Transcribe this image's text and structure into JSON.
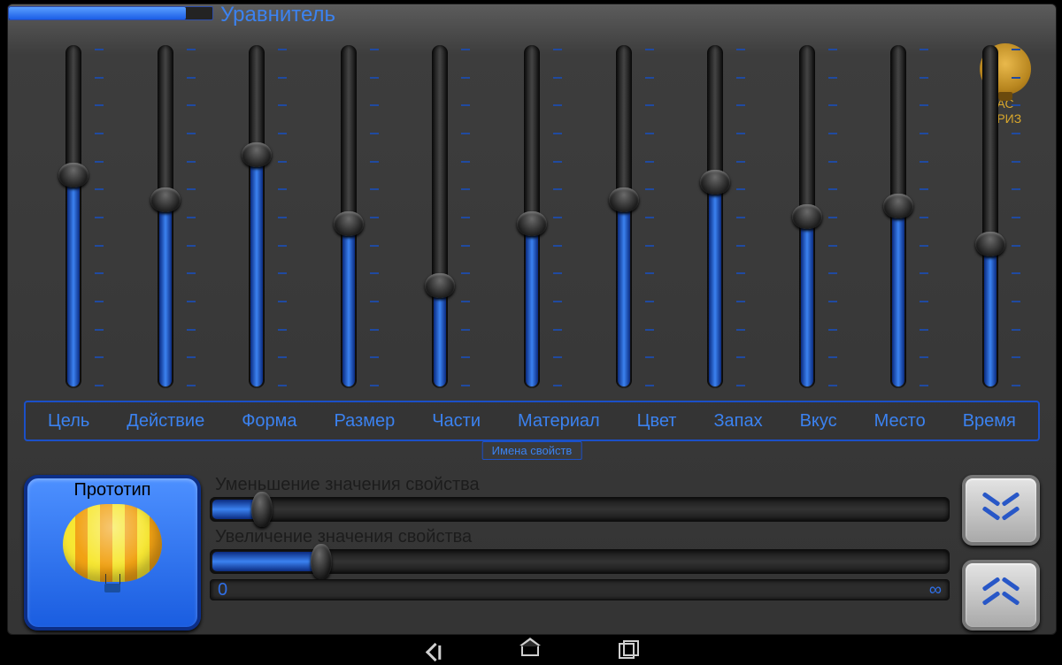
{
  "header": {
    "title": "Уравнитель",
    "progress_pct": 87
  },
  "logo": {
    "line1": "АС",
    "line2": "ТРИЗ"
  },
  "labels_caption": "Имена свойств",
  "sliders": [
    {
      "label": "Цель",
      "value": 62
    },
    {
      "label": "Действие",
      "value": 55
    },
    {
      "label": "Форма",
      "value": 68
    },
    {
      "label": "Размер",
      "value": 48
    },
    {
      "label": "Части",
      "value": 30
    },
    {
      "label": "Материал",
      "value": 48
    },
    {
      "label": "Цвет",
      "value": 55
    },
    {
      "label": "Запах",
      "value": 60
    },
    {
      "label": "Вкус",
      "value": 50
    },
    {
      "label": "Место",
      "value": 53
    },
    {
      "label": "Время",
      "value": 42
    }
  ],
  "prototype": {
    "caption": "Прототип"
  },
  "decrease": {
    "label": "Уменьшение значения свойства",
    "value": 7
  },
  "increase": {
    "label": "Увеличение значения свойства",
    "value": 15
  },
  "range": {
    "min": "0",
    "max": "∞"
  }
}
